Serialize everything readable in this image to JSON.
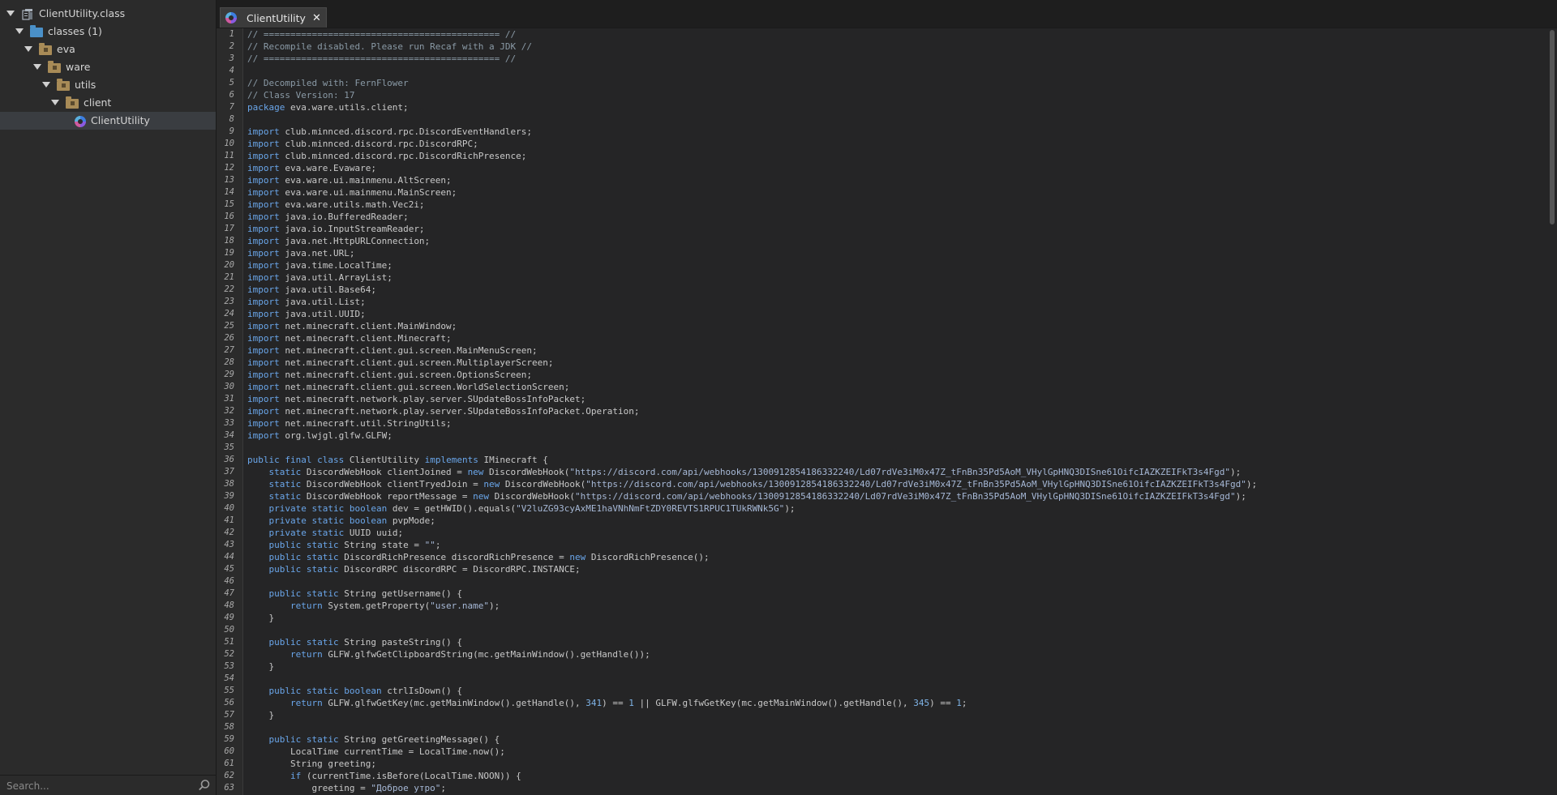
{
  "sidebar": {
    "tree": [
      {
        "label": "ClientUtility.class",
        "icon": "jar-icon",
        "indent": 0,
        "arrow": true
      },
      {
        "label": "classes (1)",
        "icon": "blue-folder-icon",
        "indent": 1,
        "arrow": true
      },
      {
        "label": "eva",
        "icon": "package-folder-icon",
        "indent": 2,
        "arrow": true
      },
      {
        "label": "ware",
        "icon": "package-folder-icon",
        "indent": 3,
        "arrow": true
      },
      {
        "label": "utils",
        "icon": "package-folder-icon",
        "indent": 4,
        "arrow": true
      },
      {
        "label": "client",
        "icon": "package-folder-icon",
        "indent": 5,
        "arrow": true
      },
      {
        "label": "ClientUtility",
        "icon": "class-icon",
        "indent": 6,
        "arrow": false,
        "selected": true
      }
    ],
    "search": {
      "placeholder": "Search..."
    }
  },
  "tabs": [
    {
      "label": "ClientUtility",
      "icon": "class-icon",
      "close": "✕"
    }
  ],
  "code_lines": [
    "// ============================================ //",
    "// Recompile disabled. Please run Recaf with a JDK //",
    "// ============================================ //",
    "",
    "// Decompiled with: FernFlower",
    "// Class Version: 17",
    "package eva.ware.utils.client;",
    "",
    "import club.minnced.discord.rpc.DiscordEventHandlers;",
    "import club.minnced.discord.rpc.DiscordRPC;",
    "import club.minnced.discord.rpc.DiscordRichPresence;",
    "import eva.ware.Evaware;",
    "import eva.ware.ui.mainmenu.AltScreen;",
    "import eva.ware.ui.mainmenu.MainScreen;",
    "import eva.ware.utils.math.Vec2i;",
    "import java.io.BufferedReader;",
    "import java.io.InputStreamReader;",
    "import java.net.HttpURLConnection;",
    "import java.net.URL;",
    "import java.time.LocalTime;",
    "import java.util.ArrayList;",
    "import java.util.Base64;",
    "import java.util.List;",
    "import java.util.UUID;",
    "import net.minecraft.client.MainWindow;",
    "import net.minecraft.client.Minecraft;",
    "import net.minecraft.client.gui.screen.MainMenuScreen;",
    "import net.minecraft.client.gui.screen.MultiplayerScreen;",
    "import net.minecraft.client.gui.screen.OptionsScreen;",
    "import net.minecraft.client.gui.screen.WorldSelectionScreen;",
    "import net.minecraft.network.play.server.SUpdateBossInfoPacket;",
    "import net.minecraft.network.play.server.SUpdateBossInfoPacket.Operation;",
    "import net.minecraft.util.StringUtils;",
    "import org.lwjgl.glfw.GLFW;",
    "",
    "public final class ClientUtility implements IMinecraft {",
    "    static DiscordWebHook clientJoined = new DiscordWebHook(\"https://discord.com/api/webhooks/1300912854186332240/Ld07rdVe3iM0x47Z_tFnBn35Pd5AoM_VHylGpHNQ3DISne61OifcIAZKZEIFkT3s4Fgd\");",
    "    static DiscordWebHook clientTryedJoin = new DiscordWebHook(\"https://discord.com/api/webhooks/1300912854186332240/Ld07rdVe3iM0x47Z_tFnBn35Pd5AoM_VHylGpHNQ3DISne61OifcIAZKZEIFkT3s4Fgd\");",
    "    static DiscordWebHook reportMessage = new DiscordWebHook(\"https://discord.com/api/webhooks/1300912854186332240/Ld07rdVe3iM0x47Z_tFnBn35Pd5AoM_VHylGpHNQ3DISne61OifcIAZKZEIFkT3s4Fgd\");",
    "    private static boolean dev = getHWID().equals(\"V2luZG93cyAxME1haVNhNmFtZDY0REVTS1RPUC1TUkRWNk5G\");",
    "    private static boolean pvpMode;",
    "    private static UUID uuid;",
    "    public static String state = \"\";",
    "    public static DiscordRichPresence discordRichPresence = new DiscordRichPresence();",
    "    public static DiscordRPC discordRPC = DiscordRPC.INSTANCE;",
    "",
    "    public static String getUsername() {",
    "        return System.getProperty(\"user.name\");",
    "    }",
    "",
    "    public static String pasteString() {",
    "        return GLFW.glfwGetClipboardString(mc.getMainWindow().getHandle());",
    "    }",
    "",
    "    public static boolean ctrlIsDown() {",
    "        return GLFW.glfwGetKey(mc.getMainWindow().getHandle(), 341) == 1 || GLFW.glfwGetKey(mc.getMainWindow().getHandle(), 345) == 1;",
    "    }",
    "",
    "    public static String getGreetingMessage() {",
    "        LocalTime currentTime = LocalTime.now();",
    "        String greeting;",
    "        if (currentTime.isBefore(LocalTime.NOON)) {",
    "            greeting = \"Доброе утро\";"
  ],
  "colors": {
    "keyword": "#6aa6ea",
    "comment": "#8a9aa6",
    "string": "#a6b8d6",
    "text": "#c9c9c9",
    "background": "#252526"
  }
}
